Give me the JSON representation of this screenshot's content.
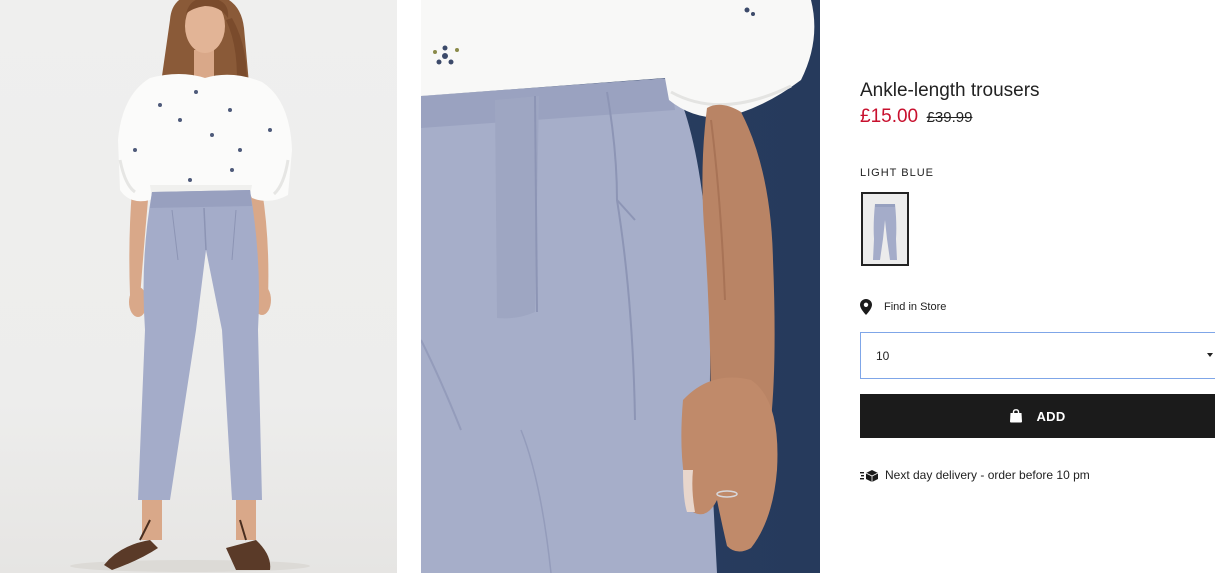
{
  "product": {
    "title": "Ankle-length trousers",
    "price_sale": "£15.00",
    "price_original": "£39.99"
  },
  "color": {
    "label": "LIGHT BLUE"
  },
  "store": {
    "find_label": "Find in Store"
  },
  "size": {
    "selected": "10"
  },
  "cart": {
    "add_label": "ADD"
  },
  "delivery": {
    "text": "Next day delivery - order before 10 pm"
  },
  "colors": {
    "sale_red": "#c8102e",
    "button_black": "#1b1b1b",
    "select_focus_border": "#7fa6e8",
    "trouser_blue": "#a4acc9",
    "detail_background": "#2c4467"
  },
  "icons": {
    "store": "location-pin-icon",
    "select": "caret-down-icon",
    "add": "shopping-bag-icon",
    "delivery": "delivery-truck-icon"
  }
}
